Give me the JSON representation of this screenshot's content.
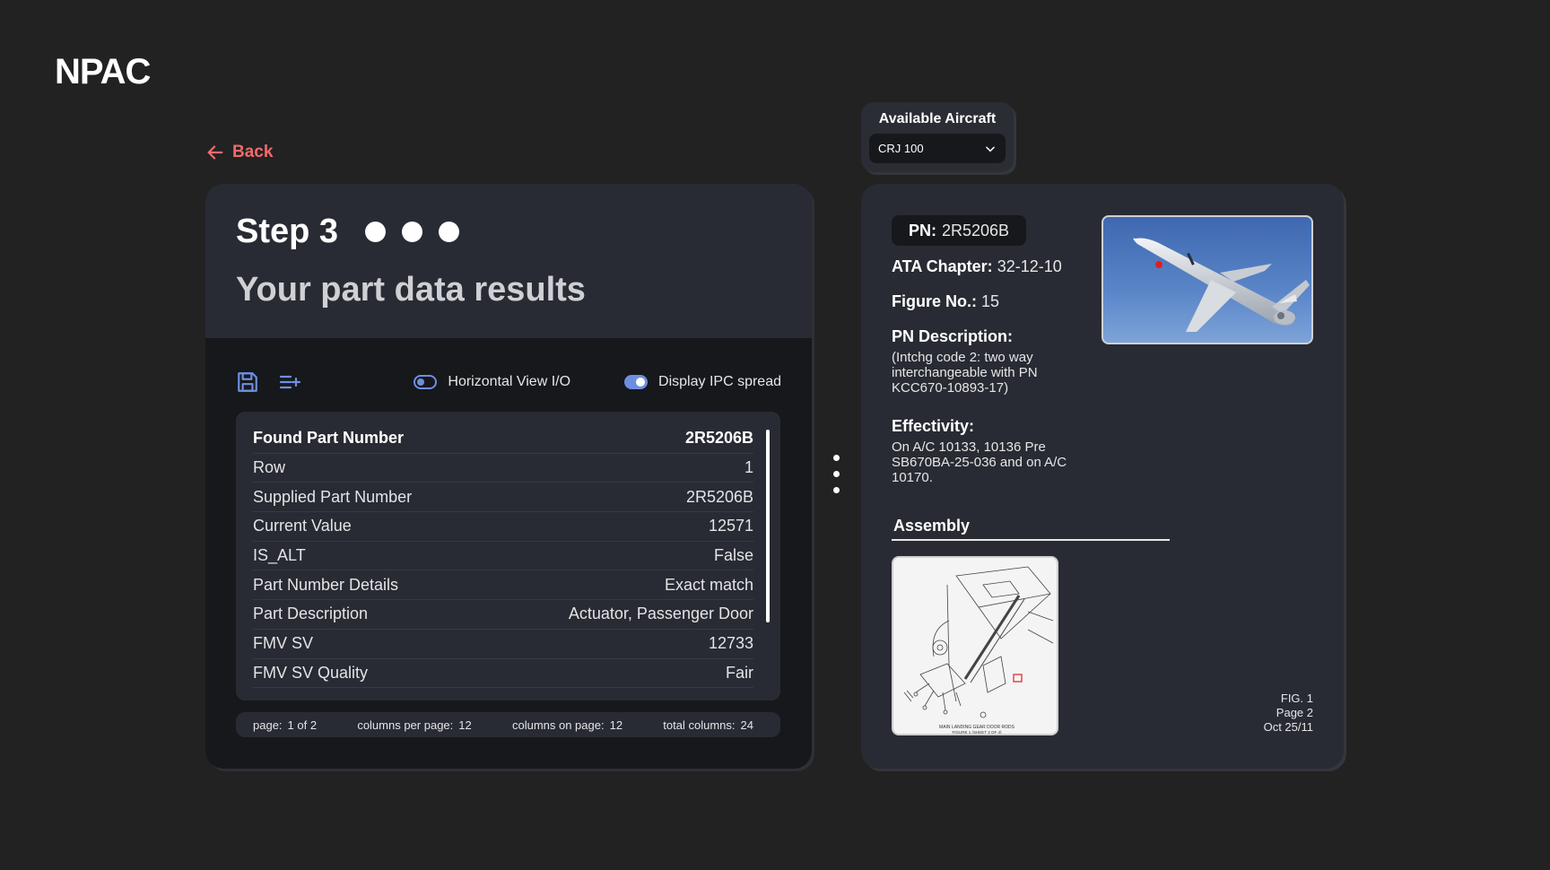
{
  "app": {
    "logo": "NPAC"
  },
  "nav": {
    "back_label": "Back"
  },
  "step": {
    "title": "Step 3",
    "subtitle": "Your part data results"
  },
  "toolbar": {
    "save_icon": "save-icon",
    "add_list_icon": "list-add-icon",
    "toggle_horizontal_label": "Horizontal View I/O",
    "toggle_horizontal_on": false,
    "toggle_ipc_label": "Display IPC spread",
    "toggle_ipc_on": true
  },
  "results": {
    "rows": [
      {
        "label": "Found Part Number",
        "value": "2R5206B"
      },
      {
        "label": "Row",
        "value": "1"
      },
      {
        "label": "Supplied Part Number",
        "value": "2R5206B"
      },
      {
        "label": "Current Value",
        "value": "12571"
      },
      {
        "label": "IS_ALT",
        "value": "False"
      },
      {
        "label": "Part Number Details",
        "value": "Exact match"
      },
      {
        "label": "Part Description",
        "value": "Actuator, Passenger Door"
      },
      {
        "label": "FMV SV",
        "value": "12733"
      },
      {
        "label": "FMV SV Quality",
        "value": "Fair"
      }
    ]
  },
  "pager": {
    "page_label": "page:",
    "page_value": "1 of 2",
    "cpp_label": "columns per page:",
    "cpp_value": "12",
    "cop_label": "columns on page:",
    "cop_value": "12",
    "total_label": "total columns:",
    "total_value": "24"
  },
  "aircraft": {
    "label": "Available Aircraft",
    "selected": "CRJ 100"
  },
  "detail": {
    "pn_label": "PN:",
    "pn_value": "2R5206B",
    "ata_label": "ATA Chapter:",
    "ata_value": "32-12-10",
    "figure_label": "Figure No.:",
    "figure_value": "15",
    "desc_title": "PN Description:",
    "desc_text": "(Intchg code 2: two way interchangeable with PN KCC670-10893-17)",
    "effectivity_title": "Effectivity:",
    "effectivity_text": "On A/C 10133, 10136 Pre SB670BA-25-036 and on A/C 10170.",
    "assembly_title": "Assembly",
    "assembly_caption": "MAIN LANDING GEAR DOOR RODS",
    "assembly_caption2": "FIGURE 1 (SHEET 3 OF 4)",
    "fig_line1": "FIG. 1",
    "fig_line2": "Page 2",
    "fig_line3": "Oct 25/11"
  },
  "colors": {
    "accent": "#6e8fe0",
    "back": "#f26a6a",
    "background": "#222223",
    "panel": "#282b33",
    "panel_dark": "#16181c"
  }
}
